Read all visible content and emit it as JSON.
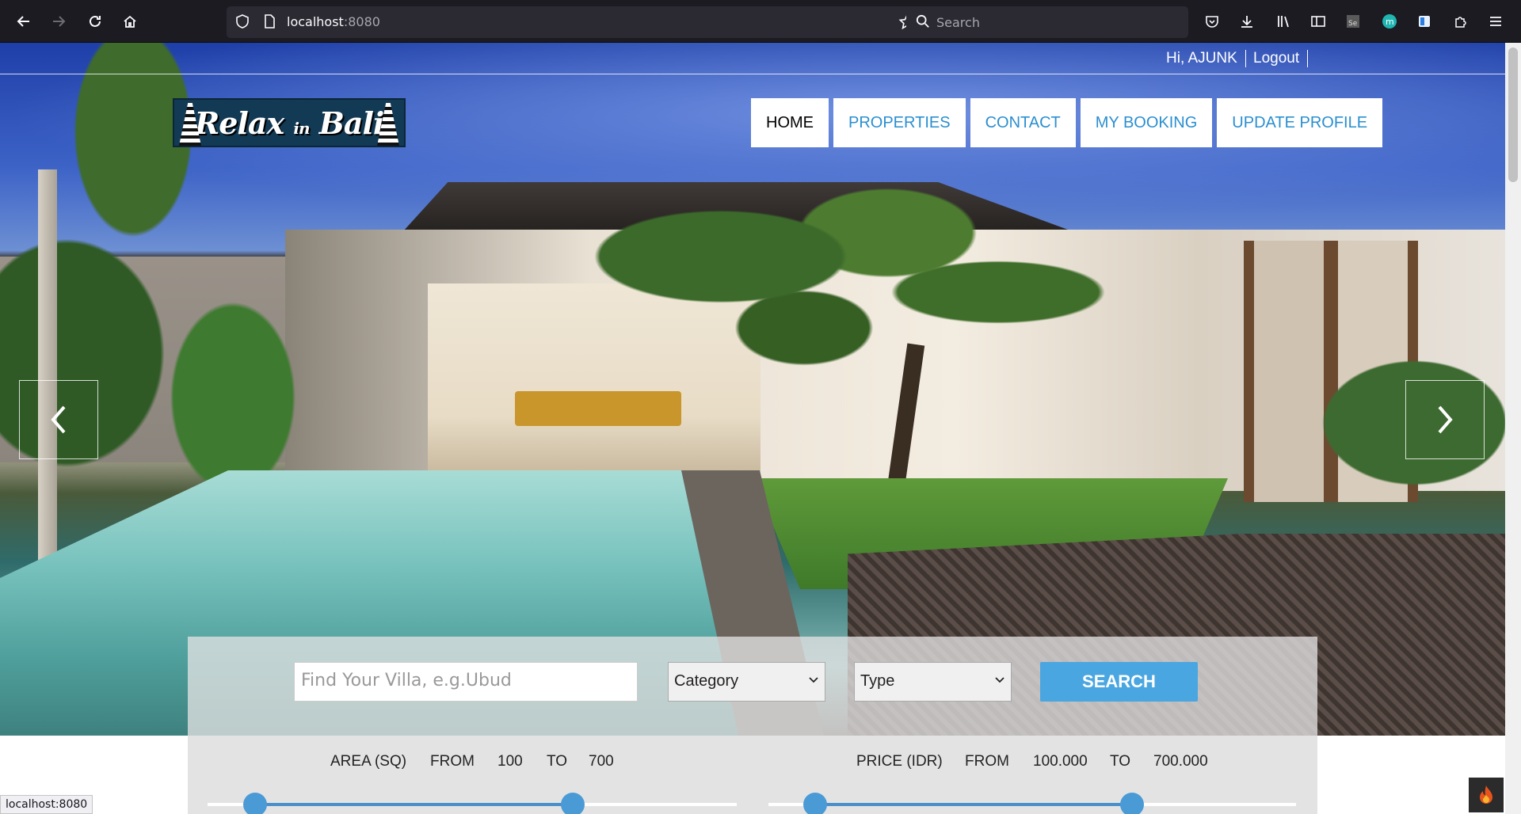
{
  "browser": {
    "url_host": "localhost",
    "url_port": ":8080",
    "search_placeholder": "Search",
    "status_url": "localhost:8080"
  },
  "header": {
    "greeting": "Hi, AJUNK",
    "logout": "Logout"
  },
  "logo": {
    "text_main": "Relax",
    "text_small": "in",
    "text_end": "Bali"
  },
  "nav": {
    "items": [
      {
        "label": "HOME",
        "active": true
      },
      {
        "label": "PROPERTIES",
        "active": false
      },
      {
        "label": "CONTACT",
        "active": false
      },
      {
        "label": "MY BOOKING",
        "active": false
      },
      {
        "label": "UPDATE PROFILE",
        "active": false
      }
    ]
  },
  "search": {
    "find_placeholder": "Find Your Villa, e.g.Ubud",
    "category_selected": "Category",
    "type_selected": "Type",
    "button_label": "SEARCH"
  },
  "filters": {
    "area": {
      "label": "AREA (SQ)",
      "from_label": "FROM",
      "from": "100",
      "to_label": "TO",
      "to": "700"
    },
    "price": {
      "label": "PRICE (IDR)",
      "from_label": "FROM",
      "from": "100.000",
      "to_label": "TO",
      "to": "700.000"
    }
  },
  "colors": {
    "accent": "#4aa6e0",
    "nav_text": "#2a8fd0",
    "chrome_bg": "#1c1b22"
  }
}
